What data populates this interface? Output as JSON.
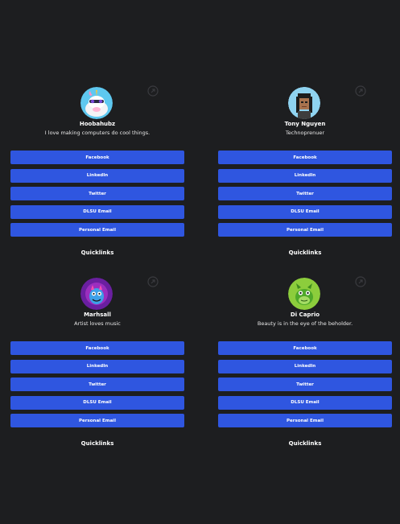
{
  "cards": [
    {
      "name": "Hoobahubz",
      "bio": "I love making computers do cool things.",
      "avatar_icon": "unicorn-avatar",
      "avatar_bg": "#5ec8f0",
      "links": [
        "Facebook",
        "LinkedIn",
        "Twitter",
        "DLSU Email",
        "Personal Email"
      ],
      "footer": "Quicklinks"
    },
    {
      "name": "Tony Nguyen",
      "bio": "Technoprenuer",
      "avatar_icon": "pixel-person-avatar",
      "avatar_bg": "#8fd3f0",
      "links": [
        "Facebook",
        "LinkedIn",
        "Twitter",
        "DLSU Email",
        "Personal Email"
      ],
      "footer": "Quicklinks"
    },
    {
      "name": "Marhsall",
      "bio": "Artist loves music",
      "avatar_icon": "purple-monster-avatar",
      "avatar_bg": "#6a1fa0",
      "links": [
        "Facebook",
        "LinkedIn",
        "Twitter",
        "DLSU Email",
        "Personal Email"
      ],
      "footer": "Quicklinks"
    },
    {
      "name": "Di Caprio",
      "bio": "Beauty is in the eye of the beholder.",
      "avatar_icon": "green-dragon-avatar",
      "avatar_bg": "#8ccd3c",
      "links": [
        "Facebook",
        "LinkedIn",
        "Twitter",
        "DLSU Email",
        "Personal Email"
      ],
      "footer": "Quicklinks"
    }
  ],
  "colors": {
    "background": "#1d1e20",
    "button": "#2f56e0",
    "text": "#ffffff"
  },
  "share_icon": "share-icon"
}
